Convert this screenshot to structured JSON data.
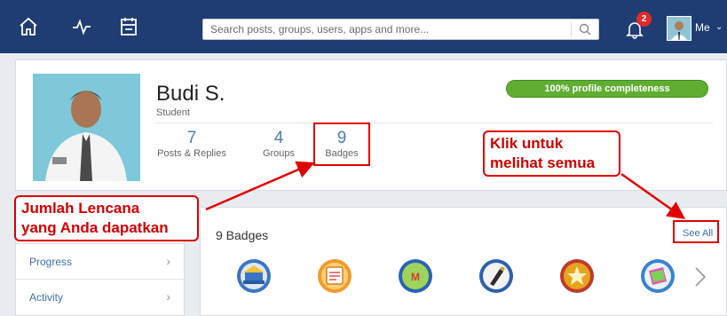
{
  "topbar": {
    "icons": [
      "home-icon",
      "activity-icon",
      "calendar-icon"
    ],
    "search_placeholder": "Search posts, groups, users, apps and more...",
    "notification_count": "2",
    "user_label": "Me"
  },
  "profile": {
    "name": "Budi S.",
    "role": "Student",
    "completeness_text": "100% profile completeness",
    "completeness_fraction": 1.0,
    "stats": [
      {
        "value": "7",
        "label": "Posts & Replies"
      },
      {
        "value": "4",
        "label": "Groups"
      },
      {
        "value": "9",
        "label": "Badges"
      }
    ]
  },
  "sidebar": {
    "items": [
      {
        "label": "Progress"
      },
      {
        "label": "Activity"
      }
    ]
  },
  "badges_section": {
    "title": "9 Badges",
    "see_all": "See All",
    "badges": [
      {
        "icon": "school-badge-icon",
        "color": "#3b74c4"
      },
      {
        "icon": "calendar-badge-icon",
        "color": "#f39a2c"
      },
      {
        "icon": "math-badge-icon",
        "color": "#2a63b5"
      },
      {
        "icon": "pen-badge-icon",
        "color": "#2f5fb1"
      },
      {
        "icon": "star-badge-icon",
        "color": "#c0392b"
      },
      {
        "icon": "book-badge-icon",
        "color": "#3a82d0"
      }
    ]
  },
  "annotations": {
    "left_callout_line1": "Jumlah Lencana",
    "left_callout_line2": "yang Anda dapatkan",
    "right_callout_line1": "Klik untuk",
    "right_callout_line2": "melihat semua"
  },
  "colors": {
    "nav": "#1f3d73",
    "accent": "#3f6fa5",
    "progress": "#5fae32",
    "annotation": "#e00000"
  }
}
